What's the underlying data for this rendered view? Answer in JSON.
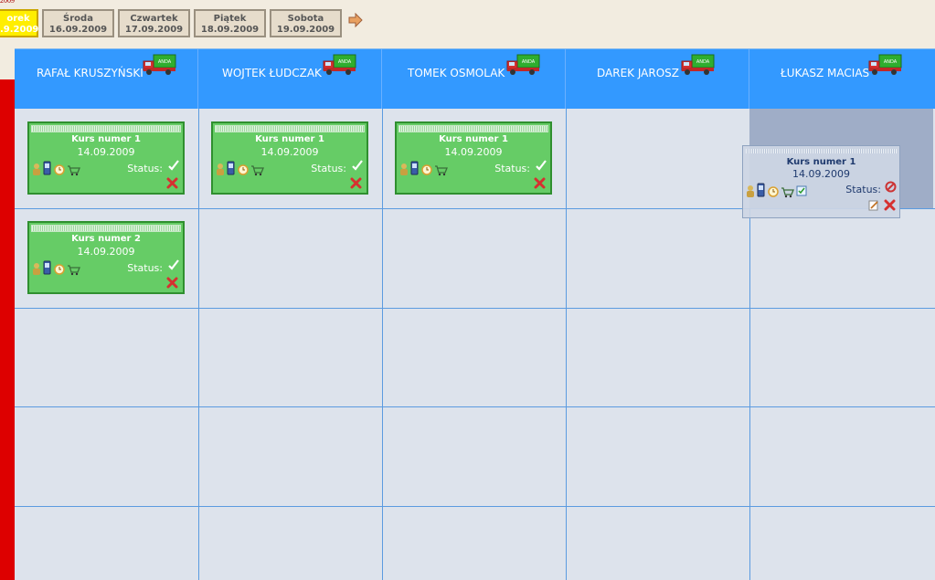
{
  "top_fragment": "2009",
  "day_tabs": [
    {
      "day": "orek",
      "date": ".9.2009",
      "active": true
    },
    {
      "day": "Środa",
      "date": "16.09.2009",
      "active": false
    },
    {
      "day": "Czwartek",
      "date": "17.09.2009",
      "active": false
    },
    {
      "day": "Piątek",
      "date": "18.09.2009",
      "active": false
    },
    {
      "day": "Sobota",
      "date": "19.09.2009",
      "active": false
    }
  ],
  "drivers": [
    {
      "name": "RAFAŁ KRUSZYŃSKI"
    },
    {
      "name": "WOJTEK ŁUDCZAK"
    },
    {
      "name": "TOMEK OSMOLAK"
    },
    {
      "name": "DAREK JAROSZ"
    },
    {
      "name": "ŁUKASZ MACIAS"
    }
  ],
  "truck_label": "ANDA",
  "cards": [
    {
      "title": "Kurs numer 1",
      "date": "14.09.2009",
      "status_label": "Status:"
    },
    {
      "title": "Kurs numer 1",
      "date": "14.09.2009",
      "status_label": "Status:"
    },
    {
      "title": "Kurs numer 1",
      "date": "14.09.2009",
      "status_label": "Status:"
    },
    {
      "title": "Kurs numer 2",
      "date": "14.09.2009",
      "status_label": "Status:"
    }
  ],
  "dragged_card": {
    "title": "Kurs numer 1",
    "date": "14.09.2009",
    "status_label": "Status:"
  },
  "colors": {
    "header_blue": "#3399ff",
    "card_green": "#66cc66",
    "grid_bg": "#dde3ec",
    "active_tab": "#ffee00",
    "side_red": "#dd0000"
  }
}
